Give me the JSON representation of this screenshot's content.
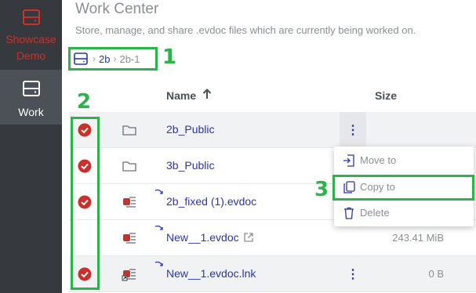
{
  "colors": {
    "sidebar": "#36393d",
    "sidebar_active": "#4c5157",
    "brand_red": "#c8312c",
    "link": "#2a36b1",
    "annotation_green": "#2cb34a"
  },
  "sidebar": {
    "items": [
      {
        "label_line1": "Showcase",
        "label_line2": "Demo",
        "icon": "drive-icon"
      },
      {
        "label": "Work",
        "icon": "drive-icon"
      }
    ]
  },
  "header": {
    "title": "Work Center",
    "subtitle": "Store, manage, and share .evdoc files which are currently being worked on."
  },
  "breadcrumb": {
    "items": [
      "2b",
      "2b-1"
    ]
  },
  "table": {
    "columns": {
      "name": "Name",
      "size": "Size"
    },
    "rows": [
      {
        "name": "2b_Public",
        "size": "",
        "type": "folder",
        "checked": true
      },
      {
        "name": "3b_Public",
        "size": "",
        "type": "folder",
        "checked": true
      },
      {
        "name": "2b_fixed (1).evdoc",
        "size": "",
        "type": "evdoc",
        "checked": true
      },
      {
        "name": "New__1.evdoc",
        "size": "243.41 MiB",
        "type": "evdoc",
        "checked": false
      },
      {
        "name": "New__1.evdoc.lnk",
        "size": "0 B",
        "type": "evdoc-link",
        "checked": true
      }
    ]
  },
  "context_menu": {
    "items": [
      "Move to",
      "Copy to",
      "Delete"
    ]
  },
  "annotations": {
    "n1": "1",
    "n2": "2",
    "n3": "3"
  }
}
